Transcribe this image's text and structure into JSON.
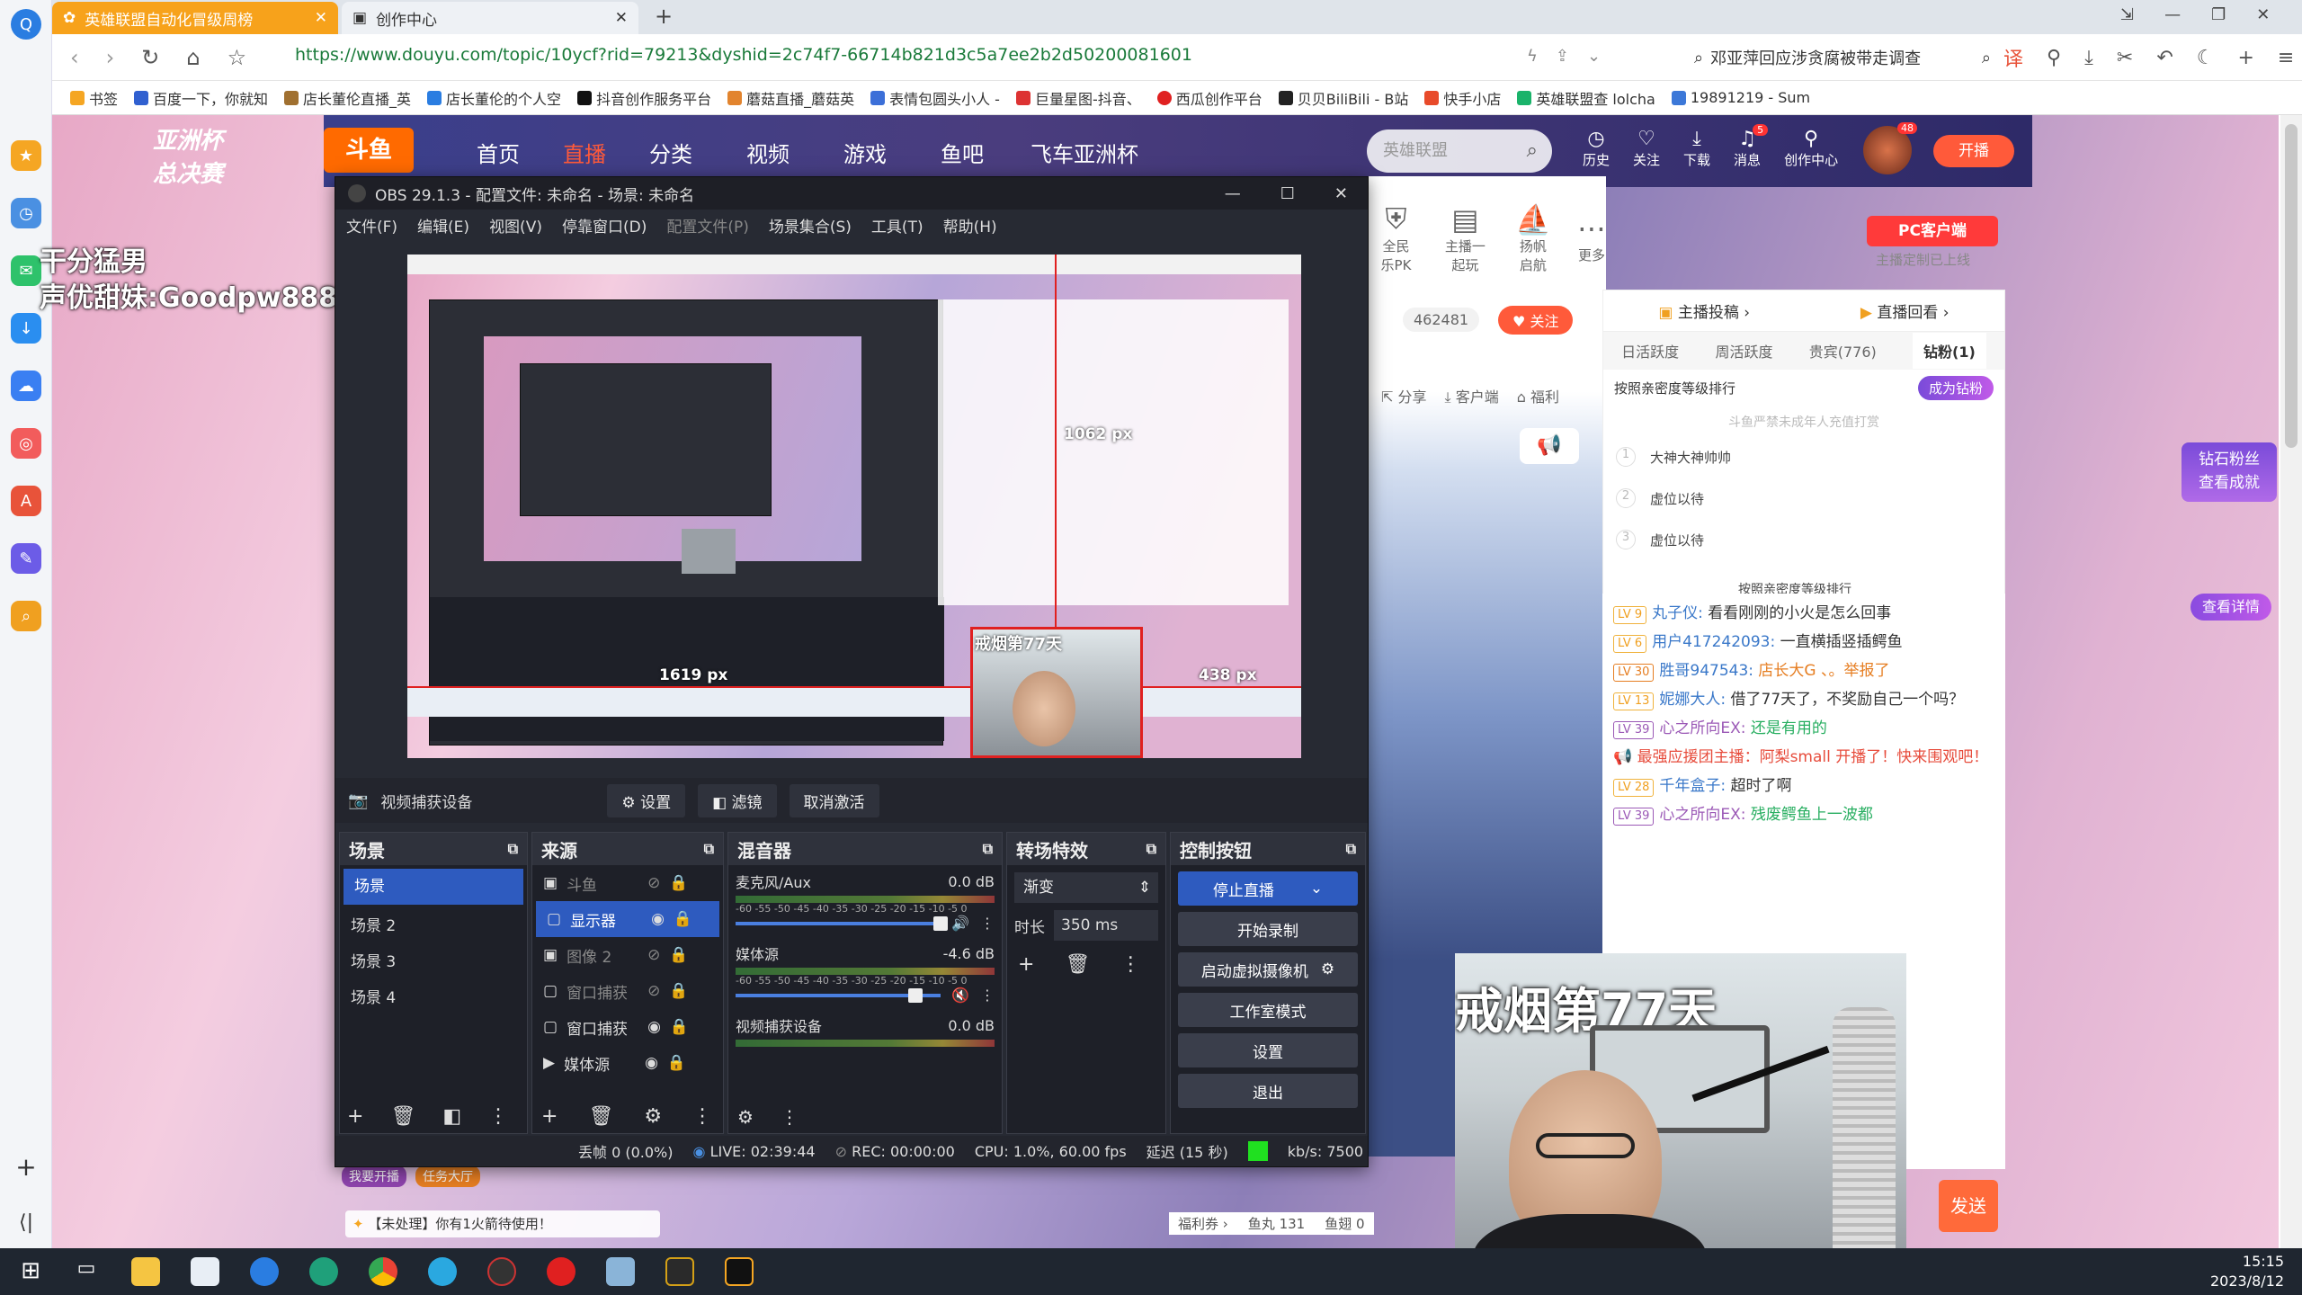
{
  "browser": {
    "tabs": [
      {
        "label": "英雄联盟自动化冒级周榜"
      },
      {
        "label": "创作中心"
      }
    ],
    "url": "https://www.douyu.com/topic/10ycf?rid=79213&dyshid=2c74f7-66714b821d3c5a7ee2b2d50200081601",
    "search_text": "邓亚萍回应涉贪腐被带走调查",
    "bookmarks": [
      "书签",
      "百度一下，你就知",
      "店长董伦直播_英",
      "店长董伦的个人空",
      "抖音创作服务平台",
      "蘑菇直播_蘑菇英",
      "表情包圆头小人 -",
      "巨量星图-抖音、",
      "西瓜创作平台",
      "贝贝BiliBili - B站",
      "快手小店",
      "英雄联盟查 lolcha",
      "19891219 - Sum"
    ]
  },
  "douyu_nav": {
    "items": [
      "首页",
      "直播",
      "分类",
      "视频",
      "游戏",
      "鱼吧",
      "飞车亚洲杯"
    ],
    "search_placeholder": "英雄联盟",
    "icons": [
      "历史",
      "关注",
      "下载",
      "消息",
      "创作中心"
    ],
    "msg_badge": "5",
    "avatar_badge": "48",
    "open_btn": "开播"
  },
  "left_overlay": {
    "line1": "干分猛男",
    "line2": "声优甜妹:Goodpw888"
  },
  "obs": {
    "title": "OBS 29.1.3 - 配置文件: 未命名 - 场景: 未命名",
    "menu": [
      "文件(F)",
      "编辑(E)",
      "视图(V)",
      "停靠窗口(D)",
      "配置文件(P)",
      "场景集合(S)",
      "工具(T)",
      "帮助(H)"
    ],
    "preview": {
      "px_top": "1062 px",
      "px_left": "1619 px",
      "px_right": "438 px",
      "cam_label": "戒烟第77天"
    },
    "toolbar": {
      "source": "视频捕获设备",
      "settings": "设置",
      "filters": "滤镜",
      "deactivate": "取消激活"
    },
    "scenes": {
      "title": "场景",
      "items": [
        "场景",
        "场景 2",
        "场景 3",
        "场景 4"
      ]
    },
    "sources": {
      "title": "来源",
      "items": [
        "斗鱼",
        "显示器",
        "图像 2",
        "窗口捕获",
        "窗口捕获",
        "媒体源"
      ]
    },
    "mixer": {
      "title": "混音器",
      "channels": [
        {
          "name": "麦克风/Aux",
          "db": "0.0 dB"
        },
        {
          "name": "媒体源",
          "db": "-4.6 dB"
        },
        {
          "name": "视频捕获设备",
          "db": "0.0 dB"
        }
      ],
      "scale": "-60 -55 -50 -45 -40 -35 -30 -25 -20 -15 -10 -5 0"
    },
    "transitions": {
      "title": "转场特效",
      "type": "渐变",
      "duration_label": "时长",
      "duration": "350 ms"
    },
    "controls": {
      "title": "控制按钮",
      "items": [
        "停止直播",
        "开始录制",
        "启动虚拟摄像机",
        "工作室模式",
        "设置",
        "退出"
      ]
    },
    "status": {
      "dropped": "丢帧 0 (0.0%)",
      "live": "LIVE: 02:39:44",
      "rec": "REC: 00:00:00",
      "cpu": "CPU: 1.0%, 60.00 fps",
      "delay": "延迟 (15 秒)",
      "kbs": "kb/s: 7500"
    }
  },
  "stream_panel": {
    "buttons": [
      "全民乐PK",
      "主播一起玩",
      "扬帆启航",
      "更多"
    ],
    "pc_client": "PC客户端",
    "pc_sub": "主播定制已上线",
    "followers": "462481",
    "follow": "关注",
    "share": "分享",
    "client": "客户端",
    "welfare": "福利"
  },
  "rank": {
    "tabs_top": [
      "主播投稿",
      "直播回看"
    ],
    "tabs": [
      "日活跃度",
      "周活跃度",
      "贵宾(776)",
      "钻粉(1)"
    ],
    "subtitle": "按照亲密度等级排行",
    "become": "成为钻粉",
    "notice": "斗鱼严禁未成年人充值打赏",
    "entries": [
      {
        "rank": "1",
        "name": "大神大神帅帅"
      },
      {
        "rank": "2",
        "name": "虚位以待"
      },
      {
        "rank": "3",
        "name": "虚位以待"
      }
    ],
    "footer": "按照亲密度等级排行"
  },
  "chat": [
    {
      "lv": "LV 9",
      "user": "丸子仪:",
      "msg": "看看刚刚的小火是怎么回事"
    },
    {
      "lv": "LV 6",
      "user": "用户417242093:",
      "msg": "一直横插竖插鳄鱼"
    },
    {
      "lv": "LV 30",
      "user": "胜哥947543:",
      "msg": "店长大G 、。举报了"
    },
    {
      "lv": "LV 13",
      "user": "妮娜大人:",
      "msg": "借了77天了，不奖励自己一个吗？"
    },
    {
      "lv": "LV 39",
      "user": "心之所向EX:",
      "msg": "还是有用的"
    },
    {
      "lv": "",
      "user": "",
      "msg": "最强应援团主播：阿梨small 开播了！快来围观吧！"
    },
    {
      "lv": "LV 28",
      "user": "千年盒子:",
      "msg": "超时了啊"
    },
    {
      "lv": "LV 39",
      "user": "心之所向EX:",
      "msg": "残废鳄鱼上一波都"
    }
  ],
  "cam_overlay": "戒烟第77天",
  "bottom_bar": {
    "notice": "【未处理】你有1火箭待使用！",
    "wo_kaibo": "我要开播",
    "task": "任务大厅",
    "fish_ball": "鱼丸 131",
    "fish_fin": "鱼翅 0",
    "send": "发送",
    "welfare_coupon": "福利券"
  },
  "right_promo": {
    "line1": "钻石粉丝",
    "line2": "查看成就",
    "detail": "查看详情"
  },
  "taskbar": {
    "time": "15:15",
    "date": "2023/8/12"
  }
}
